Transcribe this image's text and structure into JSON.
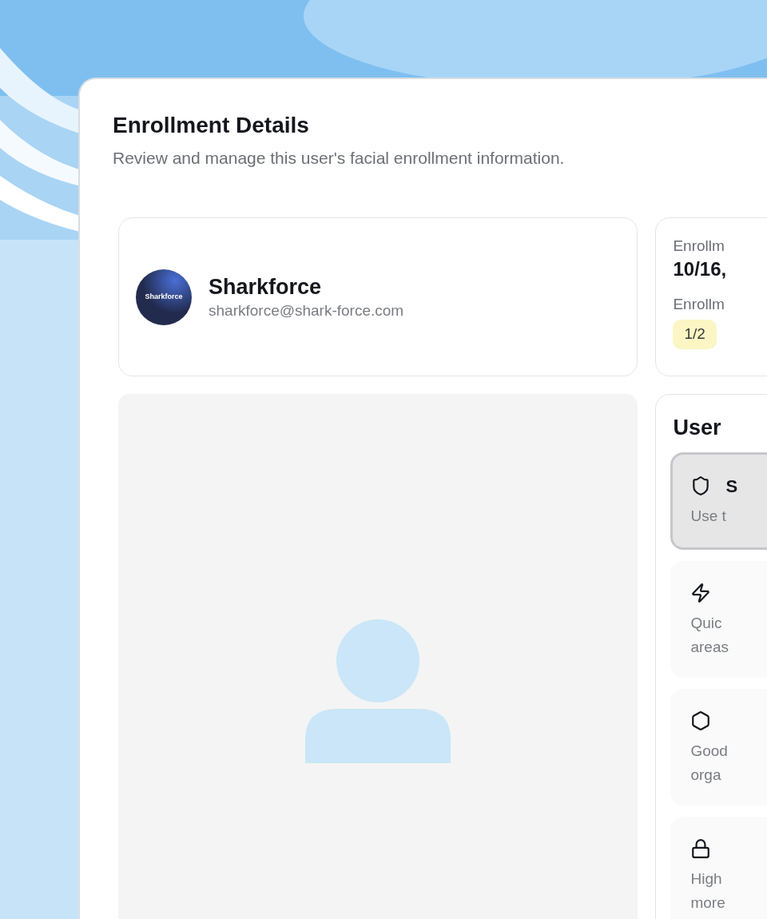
{
  "header": {
    "title": "Enrollment Details",
    "subtitle": "Review and manage this user's facial enrollment information."
  },
  "user": {
    "name": "Sharkforce",
    "email": "sharkforce@shark-force.com",
    "avatar_text": "Sharkforce"
  },
  "photo": {
    "kind": "placeholder"
  },
  "enrollment": {
    "date_label": "Enrollm",
    "date": "10/16,",
    "count_label": "Enrollm",
    "count": "1/2"
  },
  "security": {
    "title": "User",
    "options": [
      {
        "kind": "shield",
        "title": "S",
        "lines": [
          "Use t"
        ],
        "selected": true
      },
      {
        "kind": "zap",
        "lines": [
          "Quic",
          "areas"
        ],
        "selected": false
      },
      {
        "kind": "hexagon",
        "lines": [
          "Good",
          "orga"
        ],
        "selected": false
      },
      {
        "kind": "lock",
        "lines": [
          "High",
          "more"
        ],
        "selected": false
      }
    ]
  }
}
